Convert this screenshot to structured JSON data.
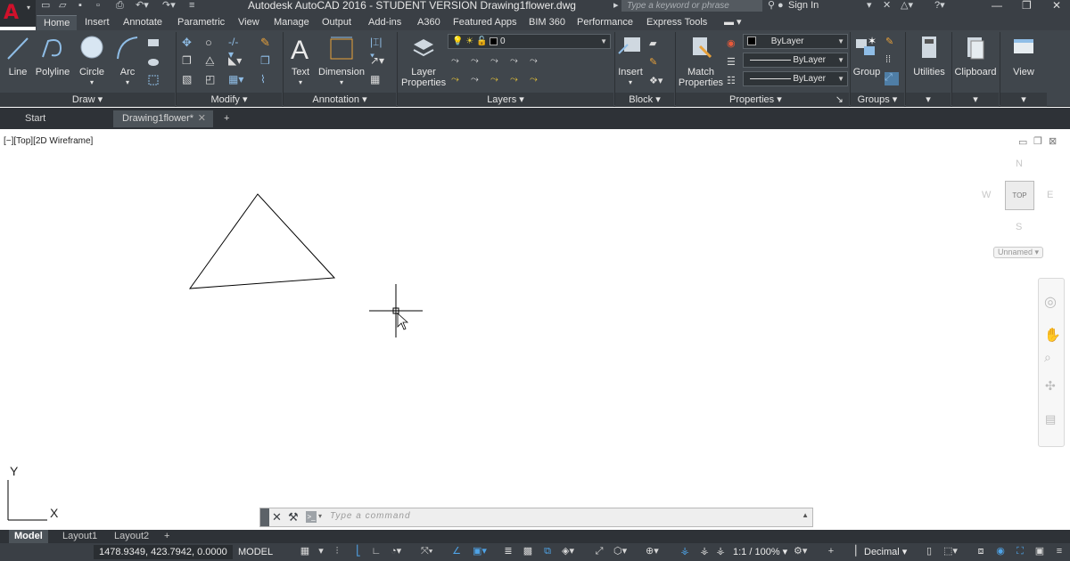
{
  "titlebar": {
    "title": "Autodesk AutoCAD 2016 - STUDENT VERSION    Drawing1flower.dwg",
    "search_placeholder": "Type a keyword or phrase",
    "sign_in": "Sign In"
  },
  "tabs": [
    "Home",
    "Insert",
    "Annotate",
    "Parametric",
    "View",
    "Manage",
    "Output",
    "Add-ins",
    "A360",
    "Featured Apps",
    "BIM 360",
    "Performance",
    "Express Tools"
  ],
  "ribbon": {
    "draw": {
      "title": "Draw",
      "line": "Line",
      "polyline": "Polyline",
      "circle": "Circle",
      "arc": "Arc"
    },
    "modify": {
      "title": "Modify"
    },
    "annotation": {
      "title": "Annotation",
      "text": "Text",
      "dimension": "Dimension"
    },
    "layers": {
      "title": "Layers",
      "layer_properties_1": "Layer",
      "layer_properties_2": "Properties",
      "current_layer": "0"
    },
    "block": {
      "title": "Block",
      "insert": "Insert"
    },
    "properties": {
      "title": "Properties",
      "match_1": "Match",
      "match_2": "Properties",
      "color": "ByLayer",
      "linetype": "ByLayer",
      "lineweight": "ByLayer"
    },
    "groups": {
      "title": "Groups",
      "group": "Group"
    },
    "utilities": "Utilities",
    "clipboard": "Clipboard",
    "view": "View"
  },
  "filetabs": {
    "start": "Start",
    "drawing": "Drawing1flower*"
  },
  "viewport": {
    "label": "[−][Top][2D Wireframe]",
    "compass": {
      "n": "N",
      "s": "S",
      "e": "E",
      "w": "W"
    },
    "viewcube": "TOP",
    "ucs_name": "Unnamed",
    "ucs_x": "X",
    "ucs_y": "Y"
  },
  "command_line": {
    "placeholder": "Type a command"
  },
  "layout_tabs": [
    "Model",
    "Layout1",
    "Layout2"
  ],
  "statusbar": {
    "coordinates": "1478.9349, 423.7942, 0.0000",
    "space": "MODEL",
    "scale": "1:1 / 100%",
    "units": "Decimal"
  },
  "colors": {
    "accent": "#d0112b",
    "ribbon_bg": "#40464c",
    "titlebar_bg": "#3a3f45"
  }
}
